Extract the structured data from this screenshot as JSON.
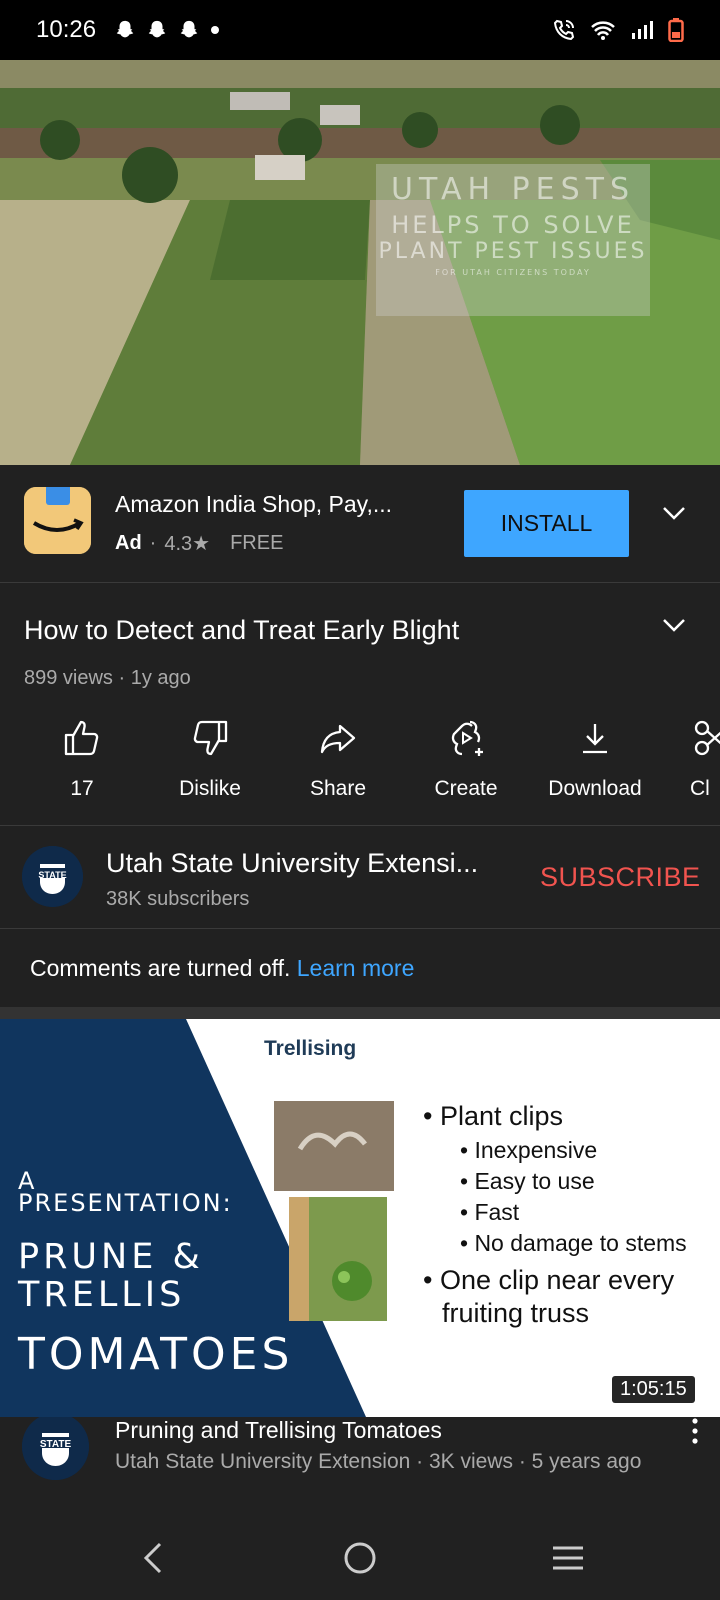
{
  "status_bar": {
    "time": "10:26",
    "notification_icons": [
      "snapchat-icon",
      "snapchat-icon",
      "snapchat-icon",
      "dot-icon"
    ],
    "right_icons": [
      "wifi-calling-icon",
      "wifi-icon",
      "signal-icon",
      "battery-low-icon"
    ]
  },
  "player": {
    "watermark_line1": "UTAH PESTS",
    "watermark_line2": "HELPS TO SOLVE",
    "watermark_line3": "PLANT PEST ISSUES",
    "watermark_line4": "FOR UTAH CITIZENS TODAY"
  },
  "ad": {
    "app_name": "Amazon India Shop, Pay,...",
    "ad_label": "Ad",
    "separator": "·",
    "rating": "4.3★",
    "price": "FREE",
    "install_label": "INSTALL"
  },
  "video": {
    "title": "How to Detect and Treat Early Blight",
    "meta": "899 views · 1y ago",
    "actions": {
      "like": "17",
      "dislike": "Dislike",
      "share": "Share",
      "create": "Create",
      "download": "Download",
      "clip": "Cl"
    }
  },
  "channel": {
    "name": "Utah State University Extensi...",
    "subscribers": "38K subscribers",
    "subscribe_label": "SUBSCRIBE",
    "avatar_text": "STATE"
  },
  "comments": {
    "text": "Comments are turned off.",
    "link": "Learn more"
  },
  "thumbnail": {
    "heading": "Trellising",
    "bullets": {
      "b1": "• Plant clips",
      "s1": "• Inexpensive",
      "s2": "• Easy to use",
      "s3": "• Fast",
      "s4": "• No damage to stems",
      "b2a": "• One clip near every",
      "b2b": "fruiting truss"
    },
    "presentation": {
      "l1": "A",
      "l2": "PRESENTATION:",
      "l3": "PRUNE &",
      "l4": "TRELLIS",
      "l5": "TOMATOES"
    },
    "duration": "1:05:15"
  },
  "next_video": {
    "title": "Pruning and Trellising Tomatoes",
    "meta": "Utah State University Extension · 3K views · 5 years ago",
    "avatar_text": "STATE"
  },
  "colors": {
    "accent_blue": "#3ea6ff",
    "subscribe_red": "#f1544f",
    "surface": "#212121"
  }
}
